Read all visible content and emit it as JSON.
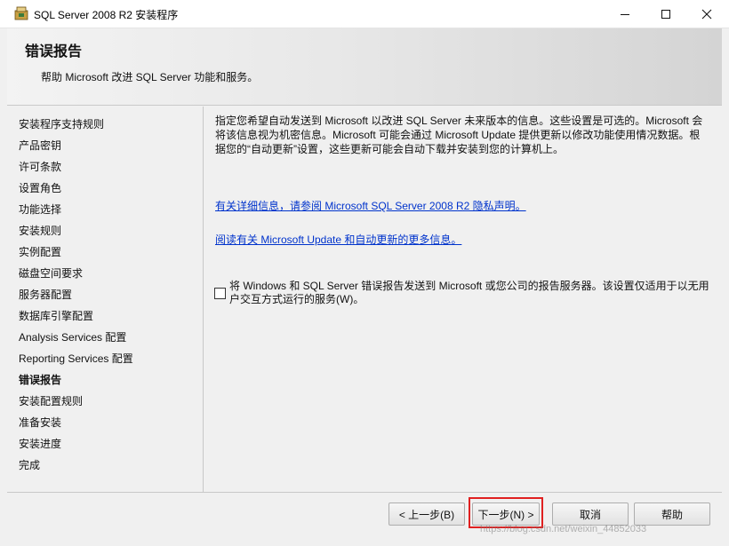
{
  "window": {
    "title": "SQL Server 2008 R2 安装程序",
    "minimize": "—",
    "maximize": "☐",
    "close": "✕"
  },
  "header": {
    "title": "错误报告",
    "subtitle": "帮助 Microsoft 改进 SQL Server 功能和服务。"
  },
  "nav": {
    "items": [
      {
        "label": "安装程序支持规则",
        "active": false
      },
      {
        "label": "产品密钥",
        "active": false
      },
      {
        "label": "许可条款",
        "active": false
      },
      {
        "label": "设置角色",
        "active": false
      },
      {
        "label": "功能选择",
        "active": false
      },
      {
        "label": "安装规则",
        "active": false
      },
      {
        "label": "实例配置",
        "active": false
      },
      {
        "label": "磁盘空间要求",
        "active": false
      },
      {
        "label": "服务器配置",
        "active": false
      },
      {
        "label": "数据库引擎配置",
        "active": false
      },
      {
        "label": "Analysis Services 配置",
        "active": false
      },
      {
        "label": "Reporting Services 配置",
        "active": false
      },
      {
        "label": "错误报告",
        "active": true
      },
      {
        "label": "安装配置规则",
        "active": false
      },
      {
        "label": "准备安装",
        "active": false
      },
      {
        "label": "安装进度",
        "active": false
      },
      {
        "label": "完成",
        "active": false
      }
    ]
  },
  "main": {
    "description": "指定您希望自动发送到 Microsoft 以改进 SQL Server 未来版本的信息。这些设置是可选的。Microsoft 会将该信息视为机密信息。Microsoft 可能会通过 Microsoft Update 提供更新以修改功能使用情况数据。根据您的“自动更新”设置，这些更新可能会自动下载并安装到您的计算机上。",
    "privacy_link": "有关详细信息，请参阅 Microsoft SQL Server 2008 R2 隐私声明。",
    "update_link": "阅读有关 Microsoft Update 和自动更新的更多信息。",
    "checkbox_checked": false,
    "checkbox_label": "将 Windows 和 SQL Server 错误报告发送到 Microsoft 或您公司的报告服务器。该设置仅适用于以无用户交互方式运行的服务(W)。"
  },
  "buttons": {
    "back": "< 上一步(B)",
    "next": "下一步(N) >",
    "cancel": "取消",
    "help": "帮助"
  },
  "watermark": "https://blog.csdn.net/weixin_44852033"
}
